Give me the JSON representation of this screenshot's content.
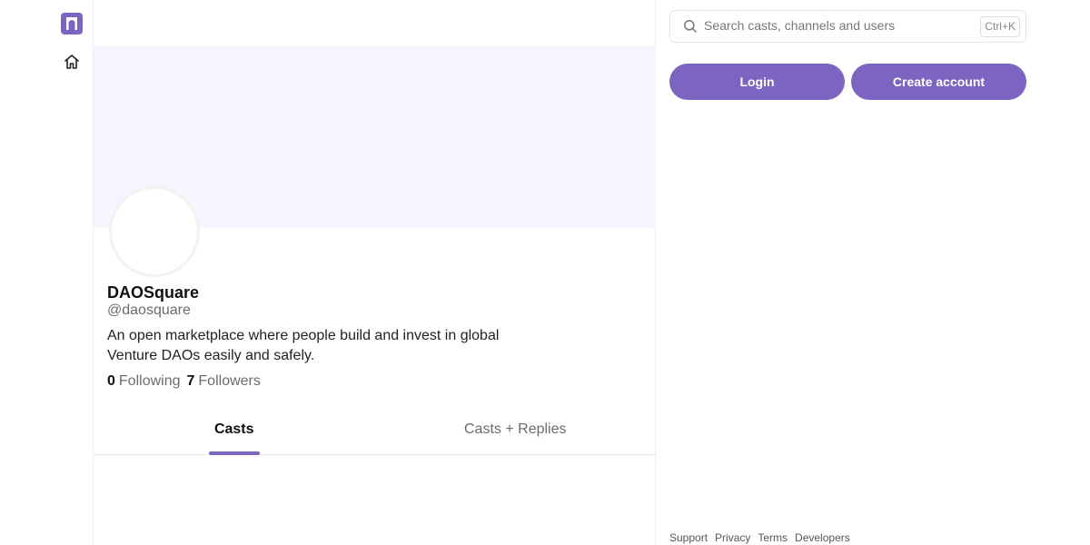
{
  "profile": {
    "display_name": "DAOSquare",
    "handle": "@daosquare",
    "bio_line1": "An open marketplace where people build and invest in global",
    "bio_line2": "Venture DAOs easily and safely.",
    "following_count": "0",
    "following_label": "Following",
    "followers_count": "7",
    "followers_label": "Followers"
  },
  "tabs": [
    {
      "label": "Casts",
      "active": true
    },
    {
      "label": "Casts + Replies",
      "active": false
    }
  ],
  "search": {
    "placeholder": "Search casts, channels and users",
    "shortcut": "Ctrl+K"
  },
  "auth": {
    "login_label": "Login",
    "create_label": "Create account"
  },
  "footer": {
    "links": [
      "Support",
      "Privacy",
      "Terms",
      "Developers"
    ]
  },
  "colors": {
    "accent": "#7c65c1",
    "banner": "#f6f5fe"
  },
  "icons": {
    "logo": "farcaster-logo",
    "home": "home-icon",
    "search": "search-icon"
  }
}
